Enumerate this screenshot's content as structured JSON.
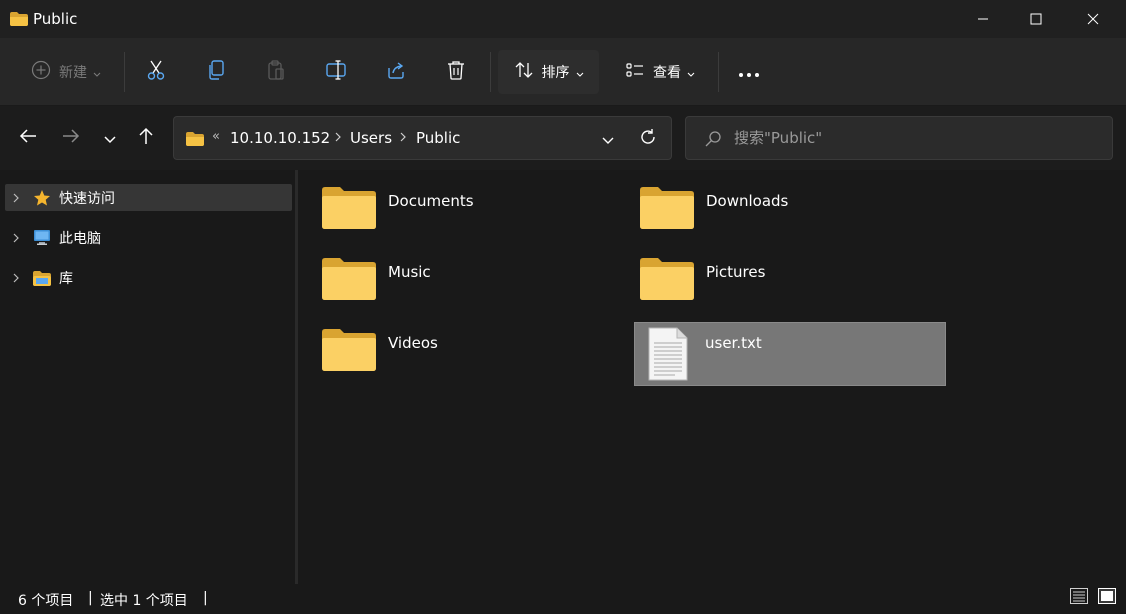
{
  "window": {
    "title": "Public",
    "minimize_icon": "minimize-icon",
    "maximize_icon": "maximize-icon",
    "close_icon": "close-icon"
  },
  "commandbar": {
    "new_label": "新建",
    "sort_label": "排序",
    "view_label": "查看",
    "icons": [
      "cut-icon",
      "copy-icon",
      "paste-icon",
      "rename-icon",
      "share-icon",
      "delete-icon",
      "more-icon"
    ]
  },
  "navigation": {
    "address": {
      "overflow": "«",
      "crumbs": [
        "10.10.10.152",
        "Users",
        "Public"
      ]
    },
    "search": {
      "placeholder": "搜索\"Public\""
    }
  },
  "sidebar": {
    "items": [
      {
        "label": "快速访问",
        "icon": "star-icon",
        "selected": true
      },
      {
        "label": "此电脑",
        "icon": "computer-icon",
        "selected": false
      },
      {
        "label": "库",
        "icon": "library-icon",
        "selected": false
      }
    ]
  },
  "content": {
    "items": [
      {
        "name": "Documents",
        "type": "folder",
        "selected": false
      },
      {
        "name": "Downloads",
        "type": "folder",
        "selected": false
      },
      {
        "name": "Music",
        "type": "folder",
        "selected": false
      },
      {
        "name": "Pictures",
        "type": "folder",
        "selected": false
      },
      {
        "name": "Videos",
        "type": "folder",
        "selected": false
      },
      {
        "name": "user.txt",
        "type": "text-file",
        "selected": true
      }
    ]
  },
  "status": {
    "item_count": "6 个项目",
    "selected_count": "选中 1 个项目",
    "separator": "|"
  },
  "colors": {
    "background": "#202020",
    "folder_yellow": "#f5c244",
    "star": "#f5b52e",
    "selection": "#777777",
    "monitor_blue": "#3d8fd6"
  }
}
